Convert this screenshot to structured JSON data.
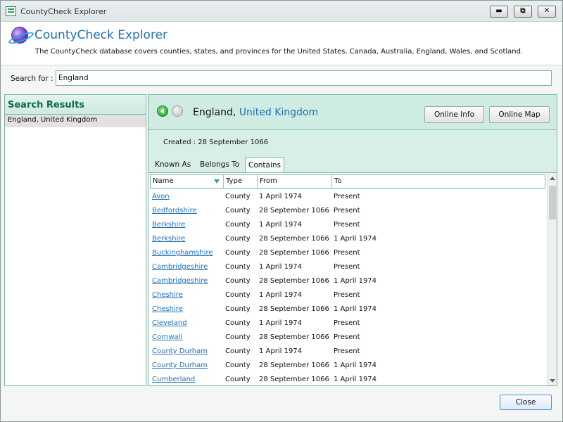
{
  "window": {
    "title": "CountyCheck Explorer",
    "controls": {
      "minimize": "▬",
      "restore": "⧉",
      "close": "✕"
    }
  },
  "header": {
    "title": "CountyCheck Explorer",
    "description": "The CountyCheck database covers counties, states, and provinces for the United States, Canada, Australia, England, Wales, and Scotland.",
    "icon": "globe-icon"
  },
  "search": {
    "label": "Search for :",
    "value": "England"
  },
  "results": {
    "title": "Search Results",
    "items": [
      "England, United Kingdom"
    ]
  },
  "detail": {
    "place": "England,",
    "place_link": "United Kingdom",
    "online_info": "Online Info",
    "online_map": "Online Map",
    "created": "Created :  28 September 1066",
    "tabs": [
      "Known As",
      "Belongs To",
      "Contains"
    ],
    "active_tab": "Contains"
  },
  "grid": {
    "columns": [
      "Name",
      "Type",
      "From",
      "To"
    ],
    "rows": [
      {
        "name": "Avon",
        "type": "County",
        "from": "1 April 1974",
        "to": "Present"
      },
      {
        "name": "Bedfordshire",
        "type": "County",
        "from": "28 September 1066",
        "to": "Present"
      },
      {
        "name": "Berkshire",
        "type": "County",
        "from": "1 April 1974",
        "to": "Present"
      },
      {
        "name": "Berkshire",
        "type": "County",
        "from": "28 September 1066",
        "to": "1 April 1974"
      },
      {
        "name": "Buckinghamshire",
        "type": "County",
        "from": "28 September 1066",
        "to": "Present"
      },
      {
        "name": "Cambridgeshire",
        "type": "County",
        "from": "1 April 1974",
        "to": "Present"
      },
      {
        "name": "Cambridgeshire",
        "type": "County",
        "from": "28 September 1066",
        "to": "1 April 1974"
      },
      {
        "name": "Cheshire",
        "type": "County",
        "from": "1 April 1974",
        "to": "Present"
      },
      {
        "name": "Cheshire",
        "type": "County",
        "from": "28 September 1066",
        "to": "1 April 1974"
      },
      {
        "name": "Cleveland",
        "type": "County",
        "from": "1 April 1974",
        "to": "Present"
      },
      {
        "name": "Cornwall",
        "type": "County",
        "from": "28 September 1066",
        "to": "Present"
      },
      {
        "name": "County Durham",
        "type": "County",
        "from": "1 April 1974",
        "to": "Present"
      },
      {
        "name": "County Durham",
        "type": "County",
        "from": "28 September 1066",
        "to": "1 April 1974"
      },
      {
        "name": "Cumberland",
        "type": "County",
        "from": "28 September 1066",
        "to": "1 April 1974"
      }
    ]
  },
  "footer": {
    "close_label": "Close"
  },
  "colors": {
    "accent_link": "#1f6fb8",
    "panel_green": "#cfece3",
    "panel_border": "#7fb5a4",
    "results_title": "#0d6b52"
  }
}
